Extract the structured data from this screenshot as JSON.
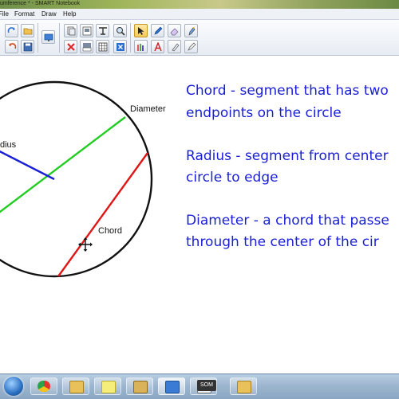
{
  "window": {
    "title": "umference * - SMART Notebook"
  },
  "menu": {
    "items": [
      {
        "label": "File"
      },
      {
        "label": "Format"
      },
      {
        "label": "Draw"
      },
      {
        "label": "Help"
      }
    ]
  },
  "toolbar": {
    "icons_row1": [
      "redo-icon",
      "open-folder-icon",
      "display-screen-icon",
      "page-copy-icon",
      "page-insert-icon",
      "text-format-icon",
      "zoom-icon",
      "select-arrow-icon",
      "pen-icon",
      "eraser-icon",
      "magic-pen-icon"
    ],
    "icons_row2": [
      "undo-icon",
      "save-icon",
      "delete-icon",
      "screen-shade-icon",
      "table-icon",
      "close-box-icon",
      "creative-pens-icon",
      "text-icon",
      "fill-icon",
      "properties-icon"
    ]
  },
  "canvas": {
    "labels": {
      "diameter": "Diameter",
      "radius": "dius",
      "chord": "Chord"
    },
    "notes": [
      {
        "line1": "Chord - segment that has two",
        "line2": "endpoints on the circle"
      },
      {
        "line1": "Radius - segment from center",
        "line2": "circle to edge"
      },
      {
        "line1": "Diameter - a chord that passe",
        "line2": "through the center of the cir"
      }
    ],
    "colors": {
      "diameter": "#22cc22",
      "radius": "#1a1fd6",
      "chord": "#e01616",
      "note_text": "#1a1fd6"
    }
  },
  "taskbar": {
    "items": [
      "start-orb-icon",
      "chrome-icon",
      "explorer-folder-icon",
      "sticky-note-icon",
      "file-manager-icon",
      "smart-notebook-icon",
      "media-player-icon",
      "screencast-icon",
      "folder-icon"
    ],
    "screencast_label": "SOM"
  }
}
